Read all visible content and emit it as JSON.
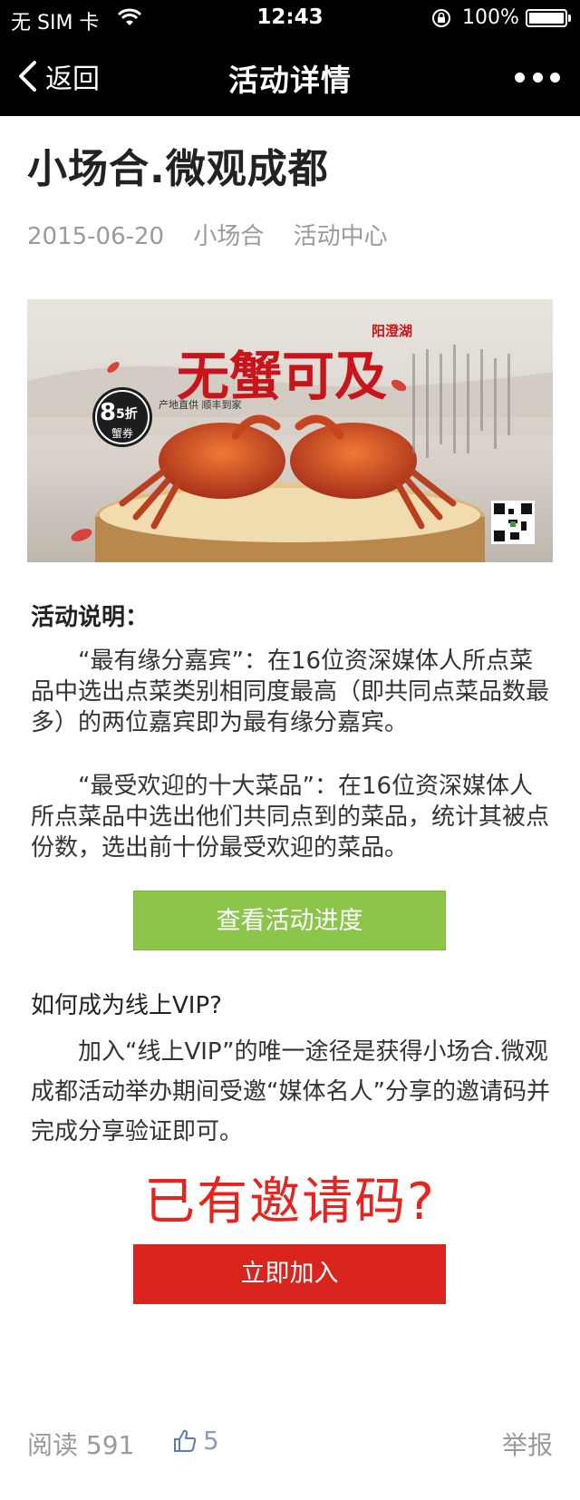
{
  "status_bar": {
    "carrier": "无 SIM 卡",
    "time": "12:43",
    "battery": "100%"
  },
  "nav": {
    "back_label": "返回",
    "title": "活动详情"
  },
  "article": {
    "title": "小场合.微观成都",
    "date": "2015-06-20",
    "author": "小场合",
    "source_link": "活动中心"
  },
  "banner": {
    "headline": "无蟹可及",
    "place": "阳澄湖",
    "tagline": "产地直供 顺丰到家",
    "badge_big": "8",
    "badge_small": "5折",
    "badge_sub": "蟹券"
  },
  "activity": {
    "heading": "活动说明：",
    "p1": "“最有缘分嘉宾”：在16位资深媒体人所点菜品中选出点菜类别相同度最高（即共同点菜品数最多）的两位嘉宾即为最有缘分嘉宾。",
    "p2": "“最受欢迎的十大菜品”：在16位资深媒体人所点菜品中选出他们共同点到的菜品，统计其被点份数，选出前十份最受欢迎的菜品。",
    "button": "查看活动进度"
  },
  "vip": {
    "heading": "如何成为线上VIP?",
    "paragraph": "加入“线上VIP”的唯一途径是获得小场合.微观成都活动举办期间受邀“媒体名人”分享的邀请码并完成分享验证即可。",
    "invite_question": "已有邀请码?",
    "join_button": "立即加入"
  },
  "footer": {
    "reads_label": "阅读",
    "reads_count": "591",
    "likes": "5",
    "report": "举报"
  },
  "colors": {
    "accent_green": "#8bc64a",
    "accent_red": "#d9251e",
    "invite_red": "#e8231d",
    "nav_bg": "#000000"
  }
}
